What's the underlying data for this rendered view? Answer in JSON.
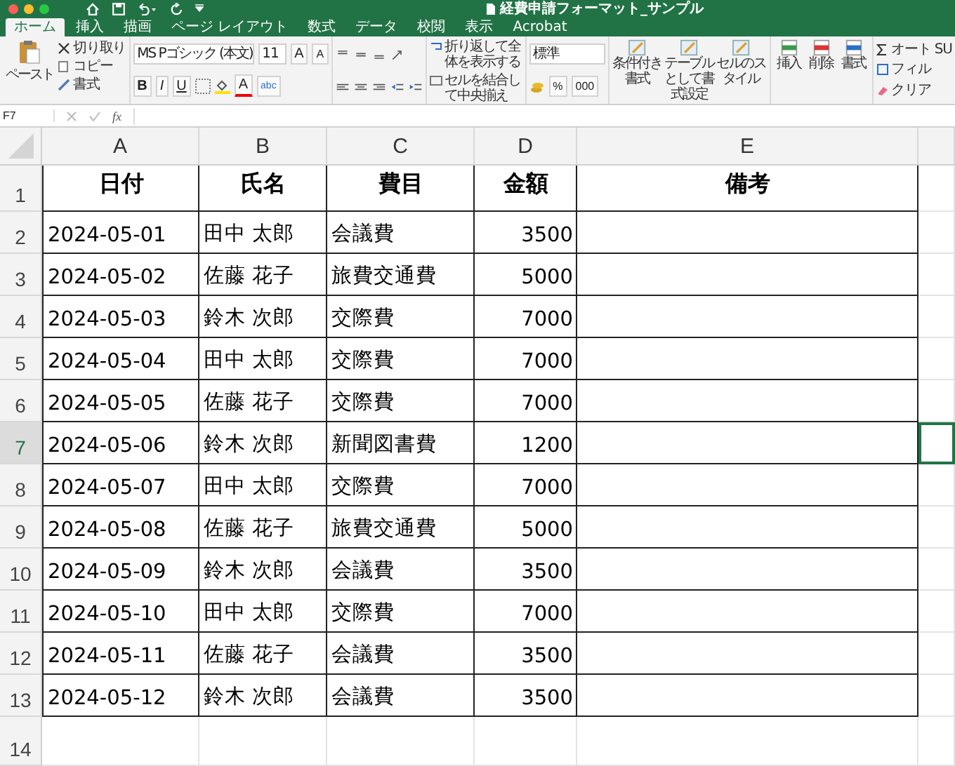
{
  "window": {
    "title": "経費申請フォーマット_サンプル"
  },
  "tabs": [
    {
      "label": "ホーム",
      "selected": true
    },
    {
      "label": "挿入",
      "selected": false
    },
    {
      "label": "描画",
      "selected": false
    },
    {
      "label": "ページ レイアウト",
      "selected": false
    },
    {
      "label": "数式",
      "selected": false
    },
    {
      "label": "データ",
      "selected": false
    },
    {
      "label": "校閲",
      "selected": false
    },
    {
      "label": "表示",
      "selected": false
    },
    {
      "label": "Acrobat",
      "selected": false
    }
  ],
  "ribbon": {
    "clipboard": {
      "paste": "ペースト",
      "cut": "切り取り",
      "copy": "コピー",
      "format": "書式"
    },
    "font": {
      "name": "MS Pゴシック (本文)",
      "size": "11",
      "grow": "A",
      "shrink": "A",
      "bold": "B",
      "italic": "I",
      "underline": "U",
      "color_letter": "A",
      "phonetic": "abc"
    },
    "alignment": {
      "wrap_text": "折り返して全体を表示する",
      "merge_center": "セルを結合して中央揃え"
    },
    "number": {
      "format": "標準",
      "percent": "%",
      "comma": "000"
    },
    "styles": [
      "条件付き書式",
      "テーブルとして書式設定",
      "セルのスタイル"
    ],
    "cells": [
      "挿入",
      "削除",
      "書式"
    ],
    "editing": [
      "オート SU",
      "フィル",
      "クリア"
    ]
  },
  "formula_bar": {
    "cell_name": "F7",
    "function_label": "fx"
  },
  "sheet": {
    "columns": [
      {
        "label": "A",
        "kind": "text"
      },
      {
        "label": "B",
        "kind": "text"
      },
      {
        "label": "C",
        "kind": "text"
      },
      {
        "label": "D",
        "kind": "number"
      },
      {
        "label": "E",
        "kind": "text"
      }
    ],
    "rows": [
      {
        "number": "1",
        "kind": "header",
        "selected": false,
        "cells": [
          "日付",
          "氏名",
          "費目",
          "金額",
          "備考"
        ]
      },
      {
        "number": "2",
        "kind": "data",
        "selected": false,
        "cells": [
          "2024-05-01",
          "田中 太郎",
          "会議費",
          "3500",
          ""
        ]
      },
      {
        "number": "3",
        "kind": "data",
        "selected": false,
        "cells": [
          "2024-05-02",
          "佐藤 花子",
          "旅費交通費",
          "5000",
          ""
        ]
      },
      {
        "number": "4",
        "kind": "data",
        "selected": false,
        "cells": [
          "2024-05-03",
          "鈴木 次郎",
          "交際費",
          "7000",
          ""
        ]
      },
      {
        "number": "5",
        "kind": "data",
        "selected": false,
        "cells": [
          "2024-05-04",
          "田中 太郎",
          "交際費",
          "7000",
          ""
        ]
      },
      {
        "number": "6",
        "kind": "data",
        "selected": false,
        "cells": [
          "2024-05-05",
          "佐藤 花子",
          "交際費",
          "7000",
          ""
        ]
      },
      {
        "number": "7",
        "kind": "data",
        "selected": true,
        "cells": [
          "2024-05-06",
          "鈴木 次郎",
          "新聞図書費",
          "1200",
          ""
        ]
      },
      {
        "number": "8",
        "kind": "data",
        "selected": false,
        "cells": [
          "2024-05-07",
          "田中 太郎",
          "交際費",
          "7000",
          ""
        ]
      },
      {
        "number": "9",
        "kind": "data",
        "selected": false,
        "cells": [
          "2024-05-08",
          "佐藤 花子",
          "旅費交通費",
          "5000",
          ""
        ]
      },
      {
        "number": "10",
        "kind": "data",
        "selected": false,
        "cells": [
          "2024-05-09",
          "鈴木 次郎",
          "会議費",
          "3500",
          ""
        ]
      },
      {
        "number": "11",
        "kind": "data",
        "selected": false,
        "cells": [
          "2024-05-10",
          "田中 太郎",
          "交際費",
          "7000",
          ""
        ]
      },
      {
        "number": "12",
        "kind": "data",
        "selected": false,
        "cells": [
          "2024-05-11",
          "佐藤 花子",
          "会議費",
          "3500",
          ""
        ]
      },
      {
        "number": "13",
        "kind": "data",
        "selected": false,
        "cells": [
          "2024-05-12",
          "鈴木 次郎",
          "会議費",
          "3500",
          ""
        ]
      },
      {
        "number": "14",
        "kind": "empty",
        "selected": false,
        "cells": []
      }
    ]
  }
}
